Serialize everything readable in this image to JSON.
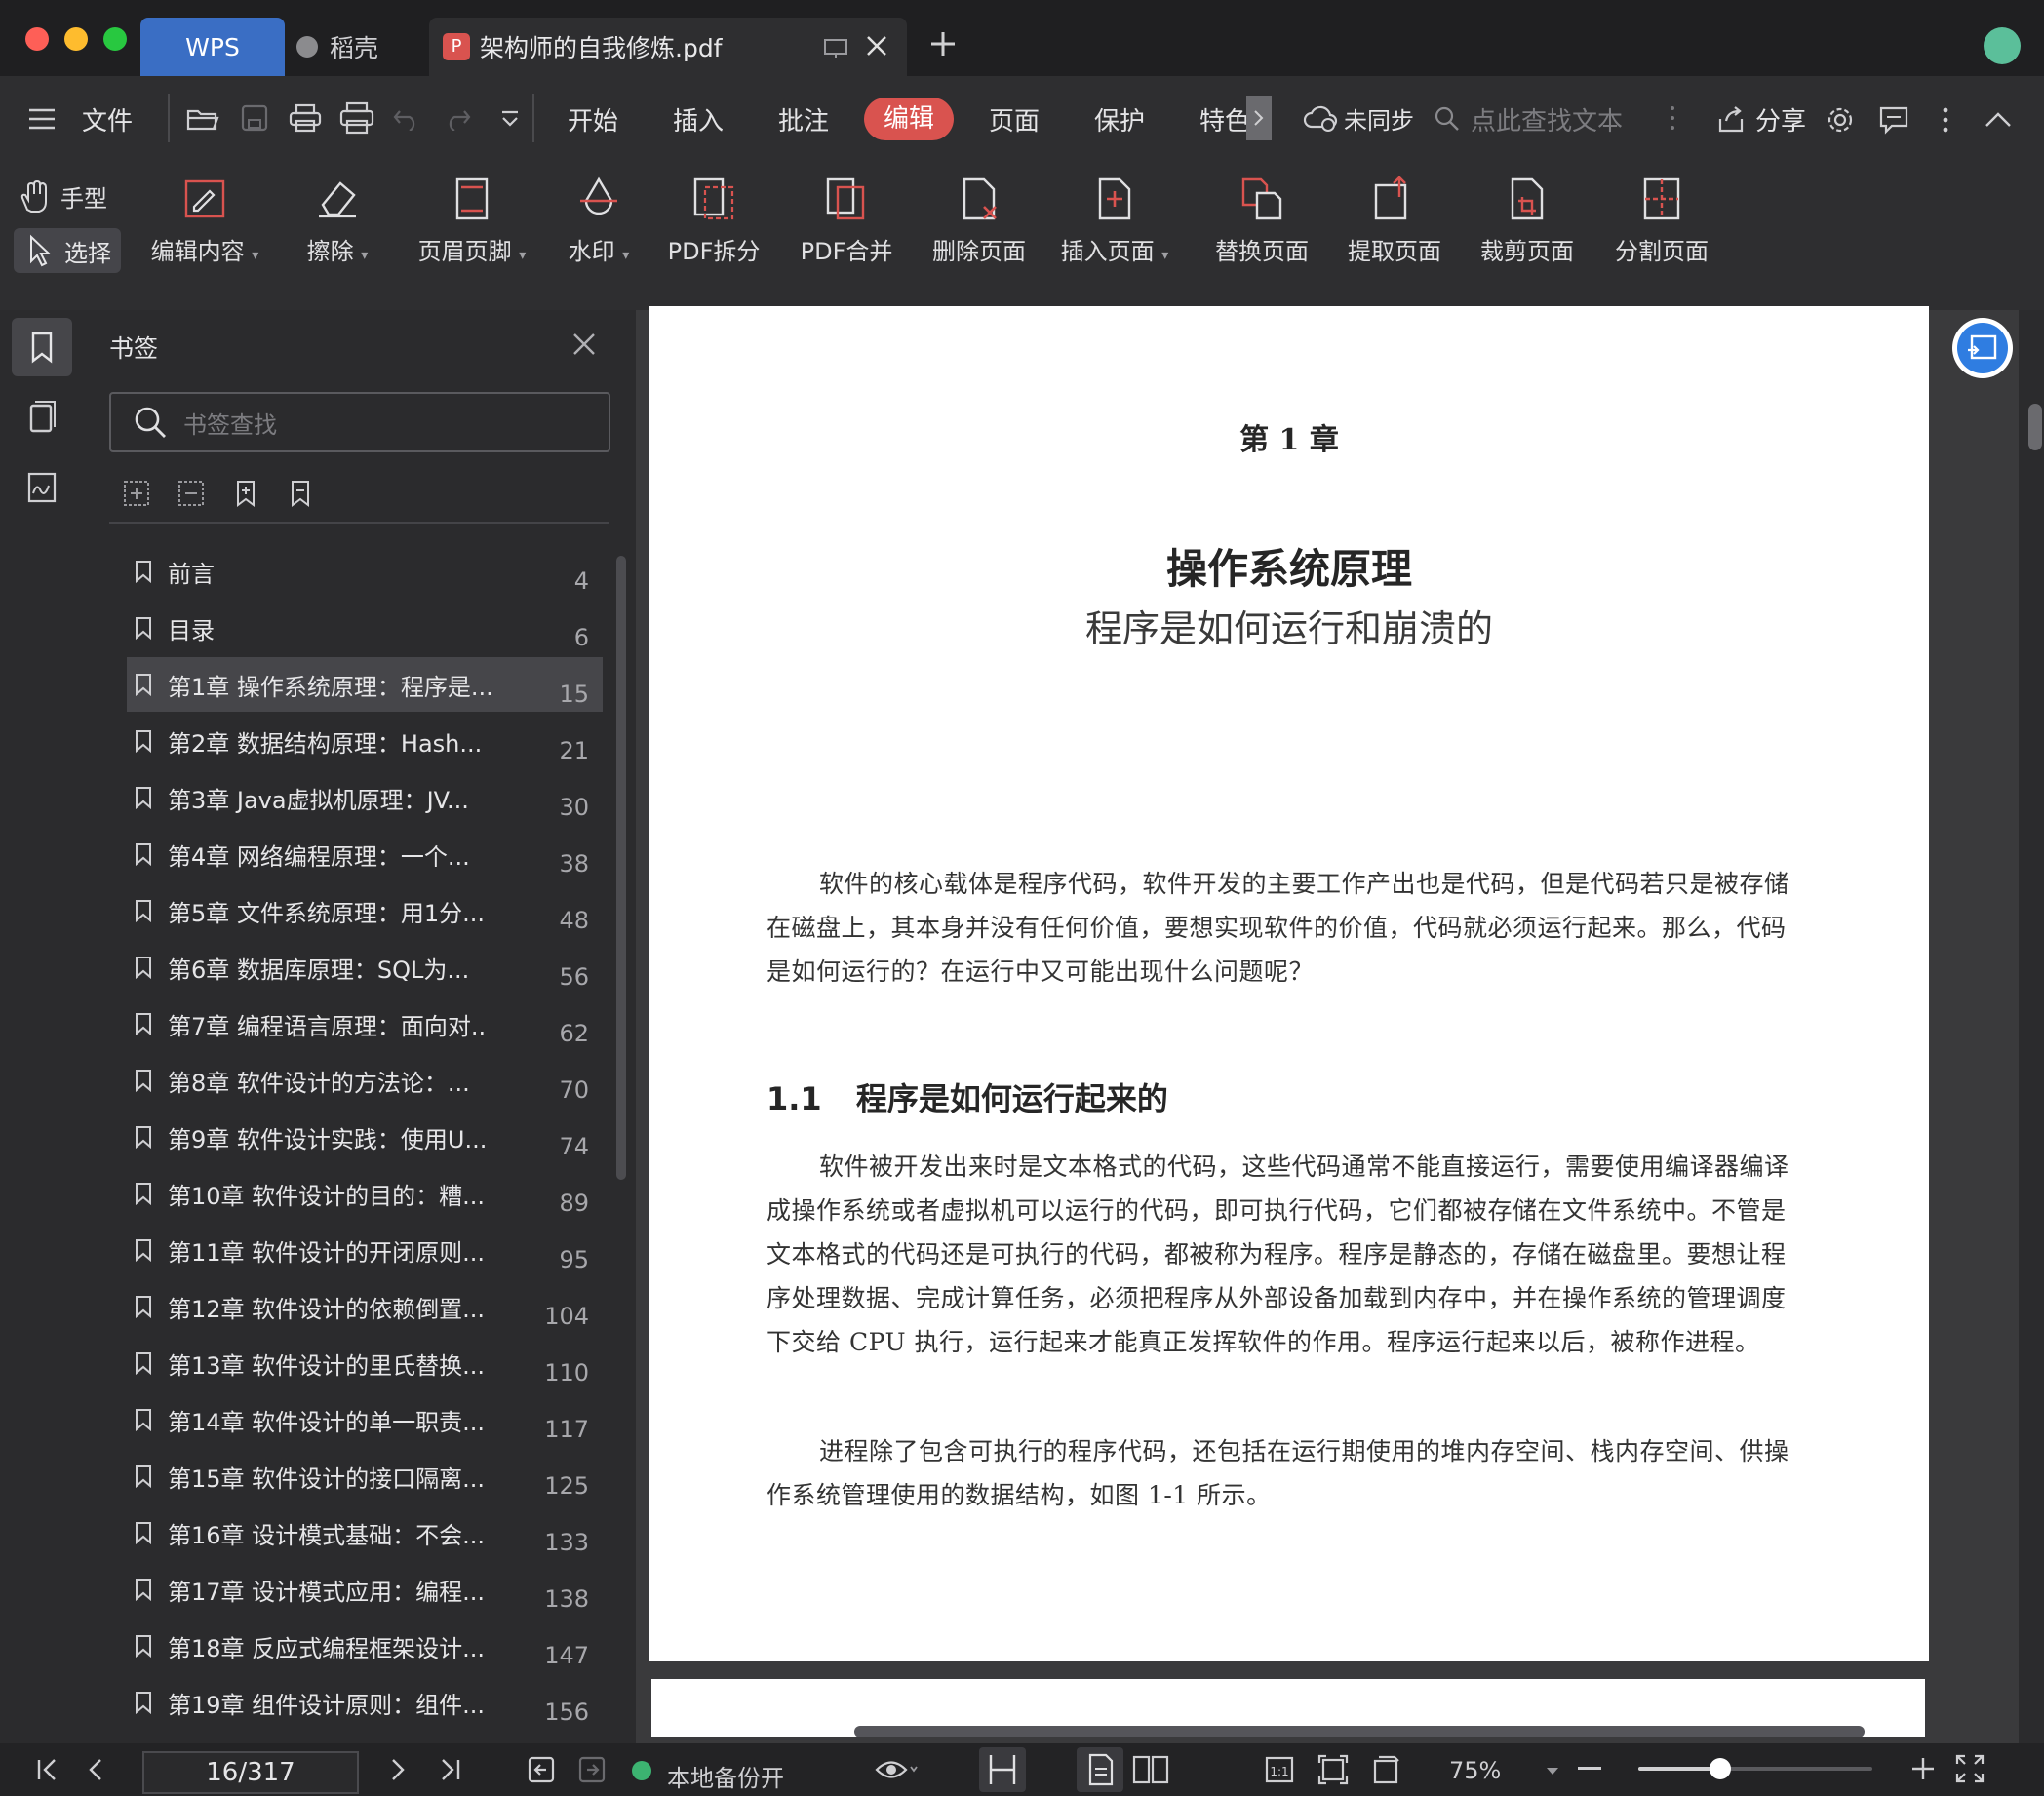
{
  "tabs": {
    "wps": "WPS",
    "docer": "稻壳",
    "file": "架构师的自我修炼.pdf"
  },
  "menu": {
    "file": "文件",
    "items": [
      "开始",
      "插入",
      "批注",
      "编辑",
      "页面",
      "保护",
      "特色"
    ],
    "active": "编辑",
    "sync": "未同步",
    "search_placeholder": "点此查找文本",
    "share": "分享"
  },
  "tools": {
    "hand": "手型",
    "select": "选择",
    "items": [
      "编辑内容",
      "擦除",
      "页眉页脚",
      "水印",
      "PDF拆分",
      "PDF合并",
      "删除页面",
      "插入页面",
      "替换页面",
      "提取页面",
      "裁剪页面",
      "分割页面"
    ]
  },
  "bookmark_panel": {
    "title": "书签",
    "search_placeholder": "书签查找",
    "items": [
      {
        "label": "前言",
        "page": "4"
      },
      {
        "label": "目录",
        "page": "6"
      },
      {
        "label": "第1章 操作系统原理：程序是...",
        "page": "15"
      },
      {
        "label": "第2章 数据结构原理：Hash...",
        "page": "21"
      },
      {
        "label": "第3章 Java虚拟机原理：JV...",
        "page": "30"
      },
      {
        "label": "第4章 网络编程原理：一个...",
        "page": "38"
      },
      {
        "label": "第5章 文件系统原理：用1分...",
        "page": "48"
      },
      {
        "label": "第6章 数据库原理：SQL为...",
        "page": "56"
      },
      {
        "label": "第7章 编程语言原理：面向对..",
        "page": "62"
      },
      {
        "label": "第8章 软件设计的方法论：...",
        "page": "70"
      },
      {
        "label": "第9章 软件设计实践：使用U...",
        "page": "74"
      },
      {
        "label": "第10章 软件设计的目的：糟...",
        "page": "89"
      },
      {
        "label": "第11章 软件设计的开闭原则...",
        "page": "95"
      },
      {
        "label": "第12章 软件设计的依赖倒置...",
        "page": "104"
      },
      {
        "label": "第13章 软件设计的里氏替换...",
        "page": "110"
      },
      {
        "label": "第14章 软件设计的单一职责...",
        "page": "117"
      },
      {
        "label": "第15章 软件设计的接口隔离...",
        "page": "125"
      },
      {
        "label": "第16章 设计模式基础：不会...",
        "page": "133"
      },
      {
        "label": "第17章 设计模式应用：编程...",
        "page": "138"
      },
      {
        "label": "第18章 反应式编程框架设计...",
        "page": "147"
      },
      {
        "label": "第19章 组件设计原则：组件...",
        "page": "156"
      }
    ],
    "selected_index": 2
  },
  "page": {
    "chapter": "第 1 章",
    "title": "操作系统原理",
    "subtitle": "程序是如何运行和崩溃的",
    "para1": "软件的核心载体是程序代码，软件开发的主要工作产出也是代码，但是代码若只是被存储在磁盘上，其本身并没有任何价值，要想实现软件的价值，代码就必须运行起来。那么，代码是如何运行的？在运行中又可能出现什么问题呢？",
    "section_num": "1.1",
    "section_title": "程序是如何运行起来的",
    "para2": "软件被开发出来时是文本格式的代码，这些代码通常不能直接运行，需要使用编译器编译成操作系统或者虚拟机可以运行的代码，即可执行代码，它们都被存储在文件系统中。不管是文本格式的代码还是可执行的代码，都被称为程序。程序是静态的，存储在磁盘里。要想让程序处理数据、完成计算任务，必须把程序从外部设备加载到内存中，并在操作系统的管理调度下交给 CPU 执行，运行起来才能真正发挥软件的作用。程序运行起来以后，被称作进程。",
    "para3": "进程除了包含可执行的程序代码，还包括在运行期使用的堆内存空间、栈内存空间、供操作系统管理使用的数据结构，如图 1-1 所示。"
  },
  "status": {
    "page_indicator": "16/317",
    "backup": "本地备份开",
    "zoom": "75%",
    "zoom_level": 0.35
  },
  "colors": {
    "accent_red": "#d9534f",
    "wps_tab": "#3a6ec4",
    "backup_green": "#3cb371",
    "float_blue": "#2f7de1"
  }
}
